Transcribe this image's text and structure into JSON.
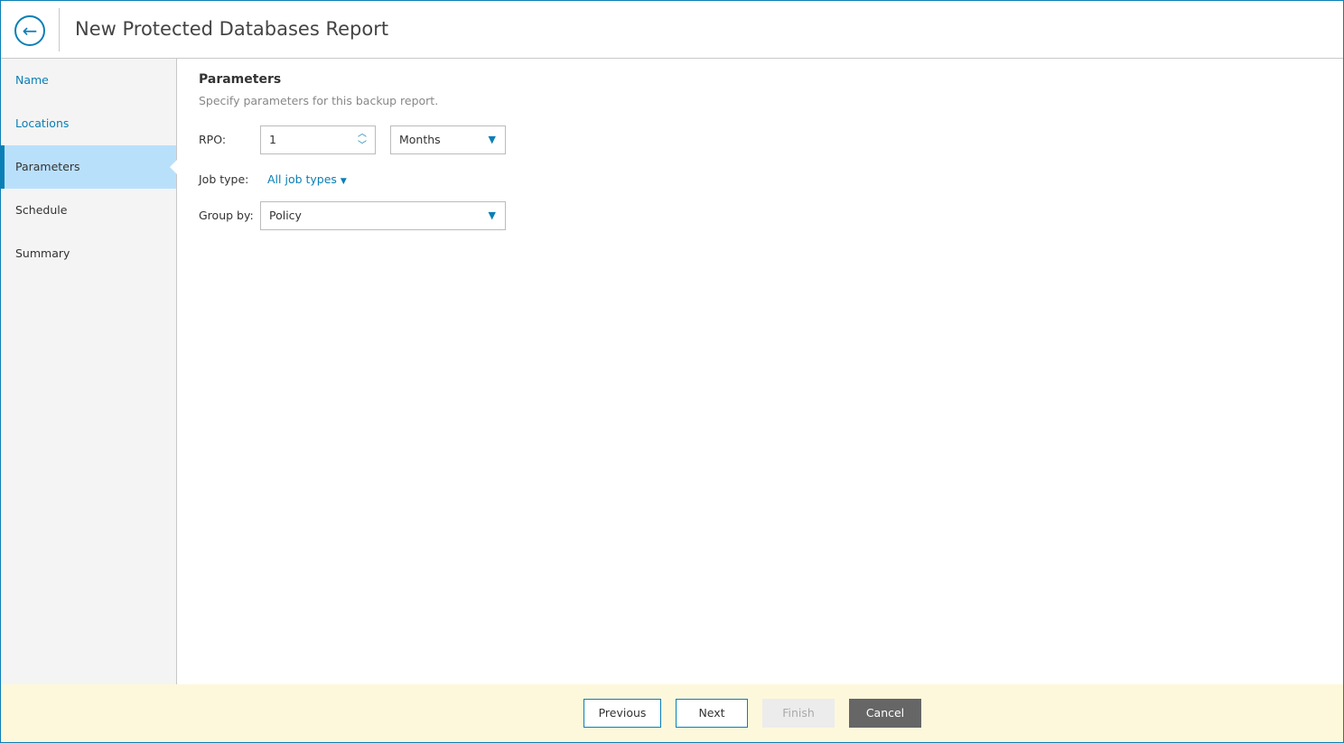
{
  "header": {
    "title": "New Protected Databases Report"
  },
  "sidebar": {
    "items": [
      {
        "label": "Name"
      },
      {
        "label": "Locations"
      },
      {
        "label": "Parameters"
      },
      {
        "label": "Schedule"
      },
      {
        "label": "Summary"
      }
    ]
  },
  "main": {
    "heading": "Parameters",
    "subtitle": "Specify parameters for this backup report.",
    "rpo_label": "RPO:",
    "rpo_value": "1",
    "rpo_unit": "Months",
    "job_type_label": "Job type:",
    "job_type_value": "All job types",
    "group_by_label": "Group by:",
    "group_by_value": "Policy"
  },
  "footer": {
    "previous": "Previous",
    "next": "Next",
    "finish": "Finish",
    "cancel": "Cancel"
  }
}
